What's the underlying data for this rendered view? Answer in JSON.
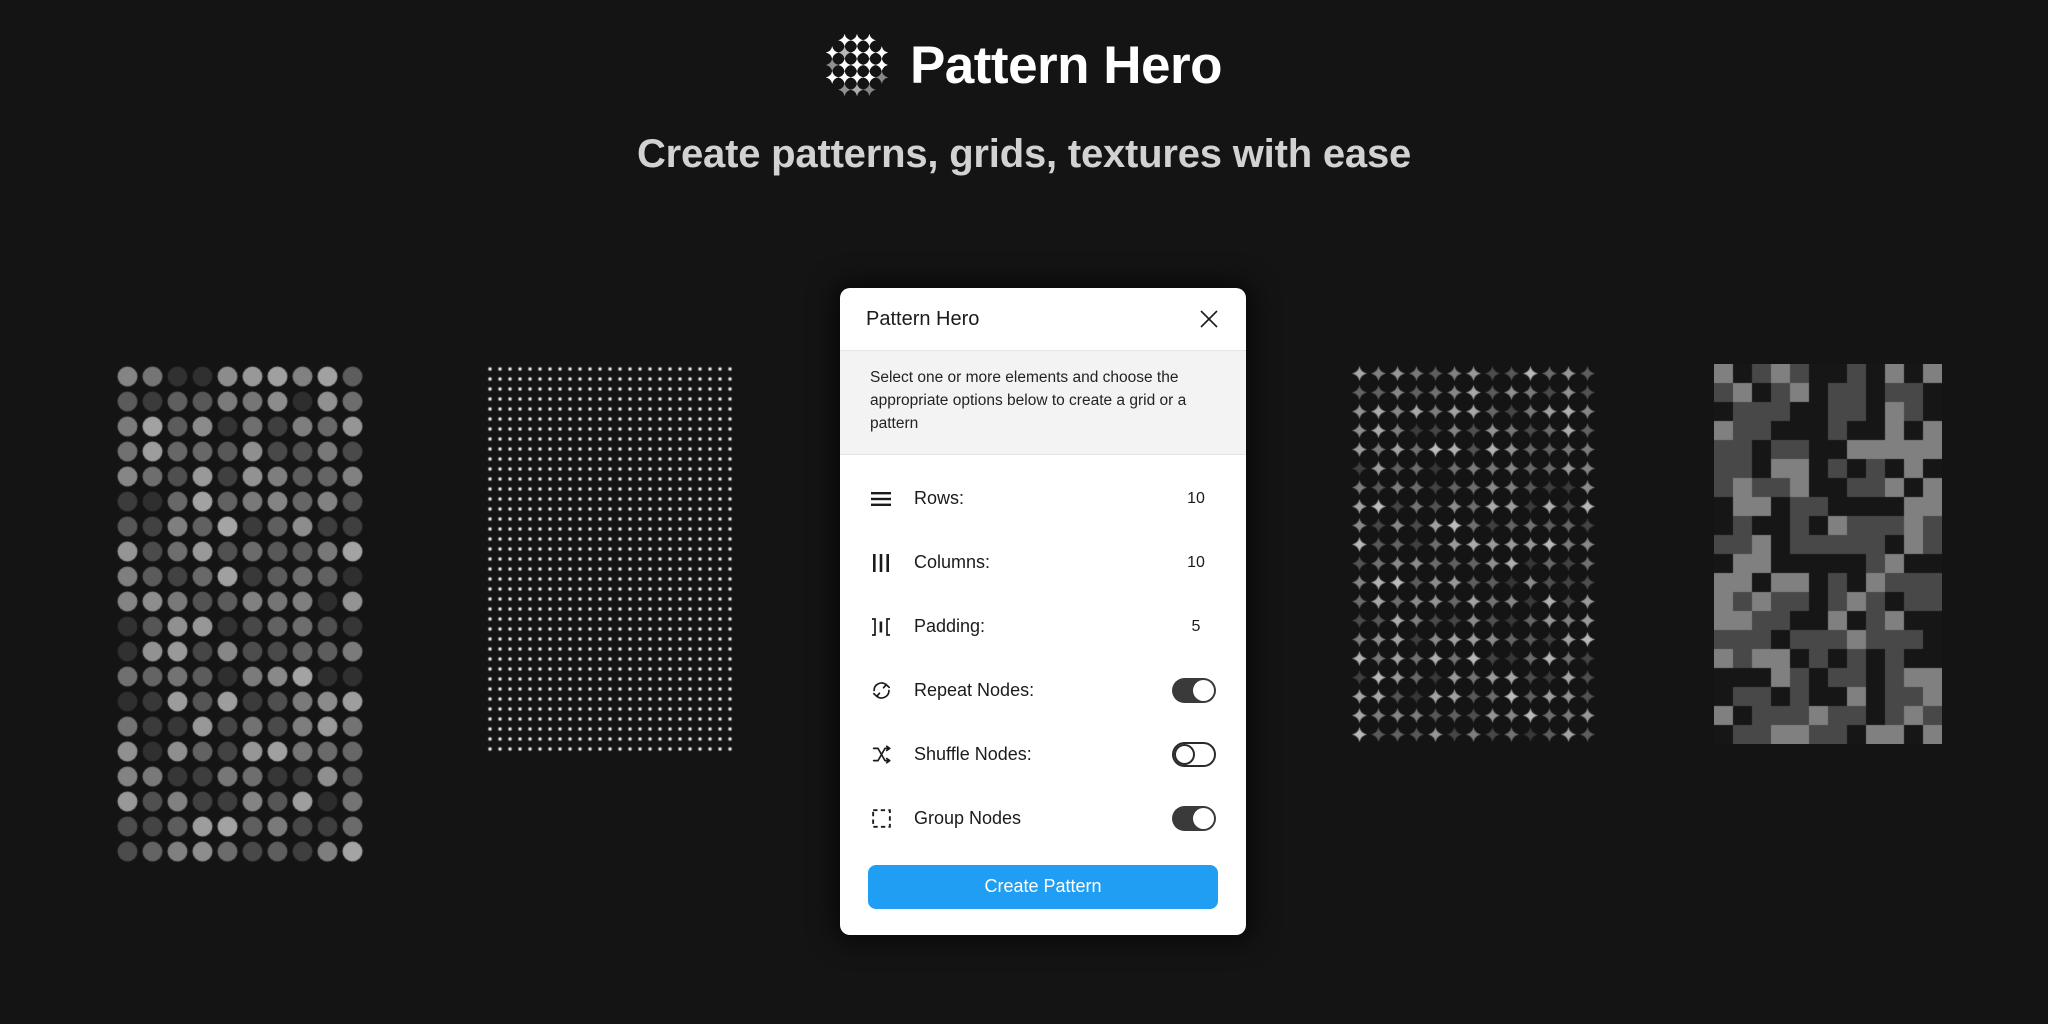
{
  "header": {
    "logo_icon": "sparkle-grid-logo-icon",
    "title": "Pattern Hero",
    "subtitle": "Create patterns, grids, textures with ease"
  },
  "colors": {
    "background": "#141414",
    "dialog_background": "#ffffff",
    "banner_background": "#f3f3f3",
    "accent_blue": "#1f9ef4",
    "toggle_on": "#3a3a3a",
    "text_dark": "#1b1b1b",
    "subtitle_gray": "#d2d2d2"
  },
  "dialog": {
    "title": "Pattern Hero",
    "close_icon": "close-icon",
    "info_text": "Select one or more elements and choose the appropriate options below to create a grid or a pattern",
    "options": [
      {
        "icon": "rows-icon",
        "label": "Rows:",
        "type": "value",
        "value": "10"
      },
      {
        "icon": "columns-icon",
        "label": "Columns:",
        "type": "value",
        "value": "10"
      },
      {
        "icon": "padding-icon",
        "label": "Padding:",
        "type": "value",
        "value": "5"
      },
      {
        "icon": "repeat-icon",
        "label": "Repeat Nodes:",
        "type": "toggle",
        "state": "on"
      },
      {
        "icon": "shuffle-icon",
        "label": "Shuffle Nodes:",
        "type": "toggle",
        "state": "off"
      },
      {
        "icon": "group-nodes-icon",
        "label": "Group Nodes",
        "type": "toggle",
        "state": "on"
      }
    ],
    "primary_button": "Create Pattern"
  },
  "decorations": [
    {
      "name": "pattern-dots-gray",
      "type": "circle-grid",
      "cols": 10,
      "rows": 20,
      "cell": 25,
      "dot": 20,
      "palette": "random-gray"
    },
    {
      "name": "pattern-dots-tiny",
      "type": "dot-grid",
      "cols": 25,
      "rows": 39,
      "cell": 10,
      "dot": 3,
      "palette": "white"
    },
    {
      "name": "pattern-sparkles",
      "type": "sparkle-grid",
      "cols": 13,
      "rows": 20,
      "cell": 19,
      "dot": 15,
      "palette": "random-gray"
    },
    {
      "name": "pattern-blocks",
      "type": "square-mosaic",
      "cols": 12,
      "rows": 20,
      "cell": 19,
      "dot": 19,
      "palette": "random-gray-blocks"
    }
  ]
}
